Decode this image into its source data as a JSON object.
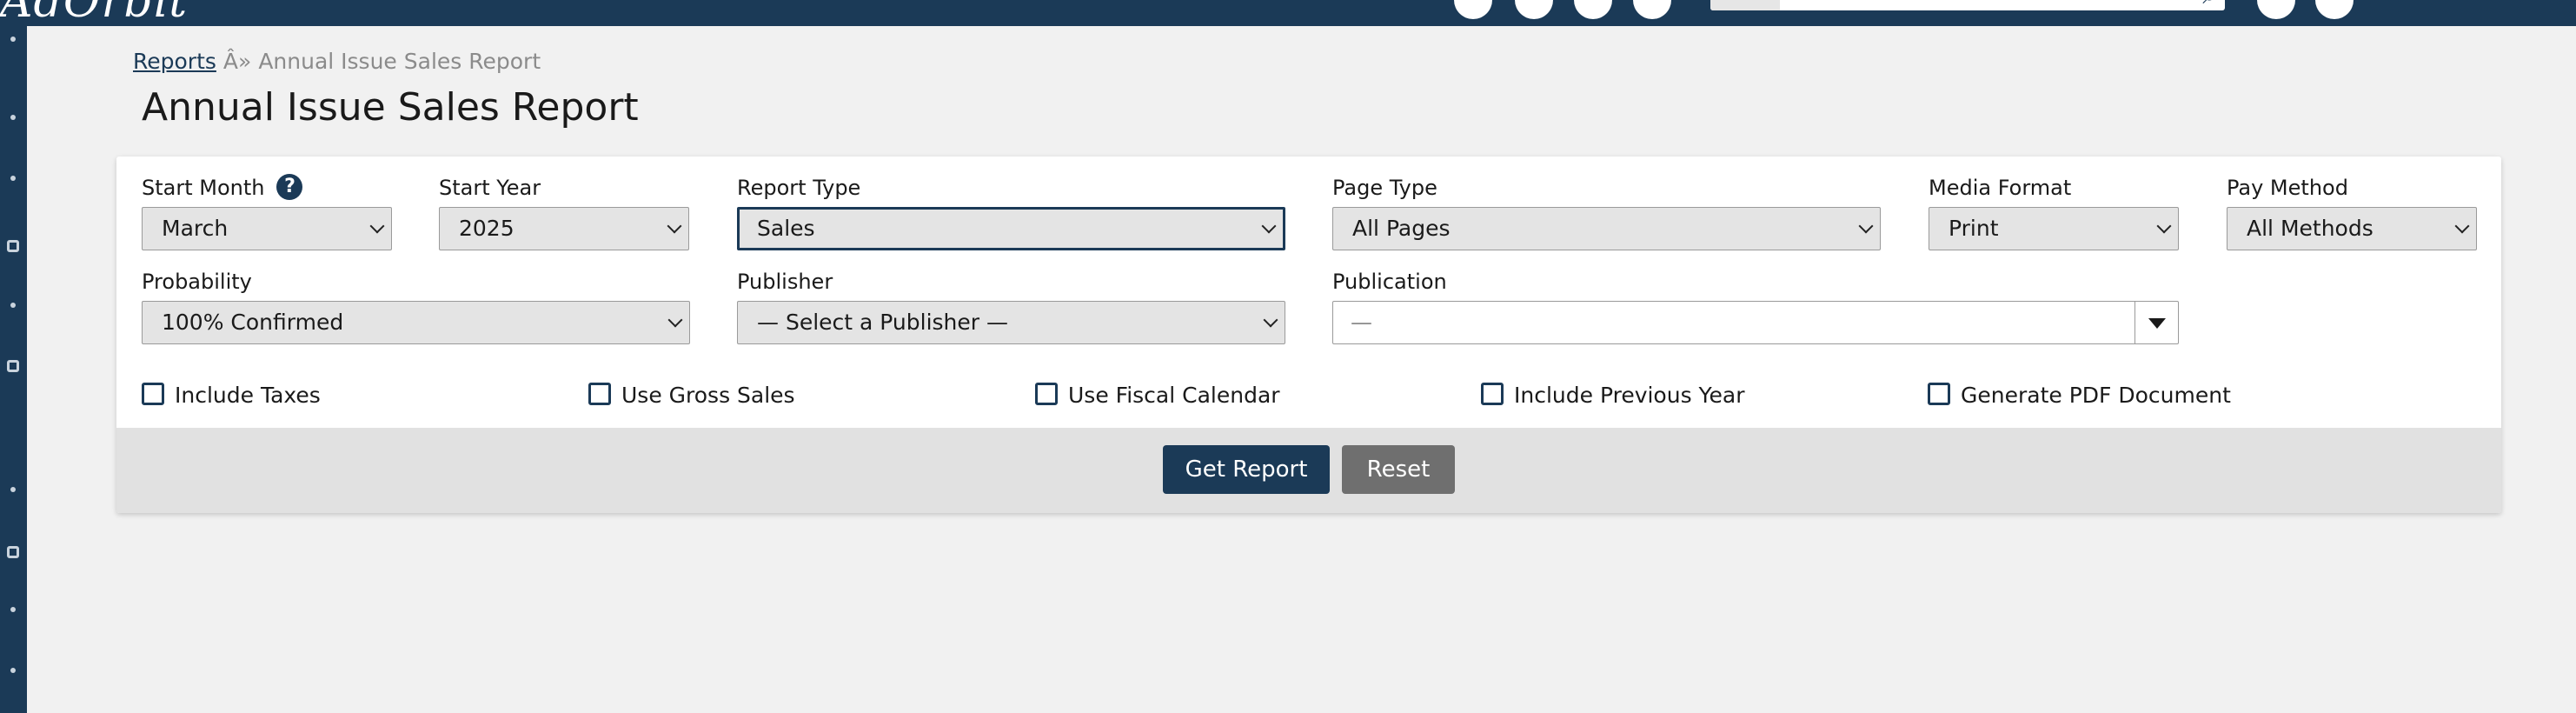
{
  "app": {
    "logo_text": "AdOrbit",
    "colors": {
      "nav": "#1b3a57",
      "primary": "#1b3a57",
      "secondary": "#6f6f6f",
      "background": "#f1f1f1"
    }
  },
  "breadcrumb": {
    "root_link": "Reports",
    "separator": "Â»",
    "current": "Annual Issue Sales Report"
  },
  "page_title": "Annual Issue Sales Report",
  "form": {
    "start_month": {
      "label": "Start Month",
      "help_icon": "?",
      "value": "March"
    },
    "start_year": {
      "label": "Start Year",
      "value": "2025"
    },
    "report_type": {
      "label": "Report Type",
      "value": "Sales"
    },
    "page_type": {
      "label": "Page Type",
      "value": "All Pages"
    },
    "media_format": {
      "label": "Media Format",
      "value": "Print"
    },
    "pay_method": {
      "label": "Pay Method",
      "value": "All Methods"
    },
    "probability": {
      "label": "Probability",
      "value": "100% Confirmed"
    },
    "publisher": {
      "label": "Publisher",
      "value": "— Select a Publisher —"
    },
    "publication": {
      "label": "Publication",
      "value": "—"
    },
    "checkboxes": {
      "include_taxes": {
        "label": "Include Taxes",
        "checked": false
      },
      "use_gross_sales": {
        "label": "Use Gross Sales",
        "checked": false
      },
      "use_fiscal_calendar": {
        "label": "Use Fiscal Calendar",
        "checked": false
      },
      "include_previous_year": {
        "label": "Include Previous Year",
        "checked": false
      },
      "generate_pdf": {
        "label": "Generate PDF Document",
        "checked": false
      }
    }
  },
  "actions": {
    "get_report": "Get Report",
    "reset": "Reset"
  }
}
